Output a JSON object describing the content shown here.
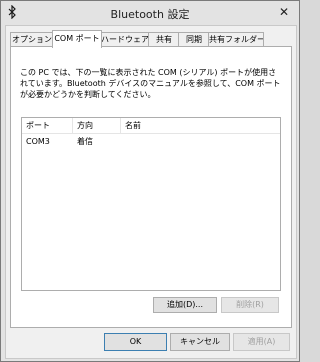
{
  "window": {
    "title": "Bluetooth 設定",
    "close_glyph": "✕"
  },
  "tabs": [
    {
      "label": "オプション",
      "active": false
    },
    {
      "label": "COM ポート",
      "active": true
    },
    {
      "label": "ハードウェア",
      "active": false
    },
    {
      "label": "共有",
      "active": false
    },
    {
      "label": "同期",
      "active": false
    },
    {
      "label": "共有フォルダー",
      "active": false
    }
  ],
  "panel": {
    "description": "この PC では、下の一覧に表示された COM (シリアル) ポートが使用されています。Bluetooth デバイスのマニュアルを参照して、COM ポートが必要かどうかを判断してください。",
    "columns": [
      "ポート",
      "方向",
      "名前"
    ],
    "rows": [
      {
        "port": "COM3",
        "direction": "着信",
        "name": ""
      }
    ],
    "add_button": "追加(D)...",
    "remove_button": "削除(R)"
  },
  "footer": {
    "ok": "OK",
    "cancel": "キャンセル",
    "apply": "適用(A)"
  },
  "colors": {
    "bluetooth_icon": "#1a1a1a",
    "default_button_border": "#3c7fb1"
  }
}
